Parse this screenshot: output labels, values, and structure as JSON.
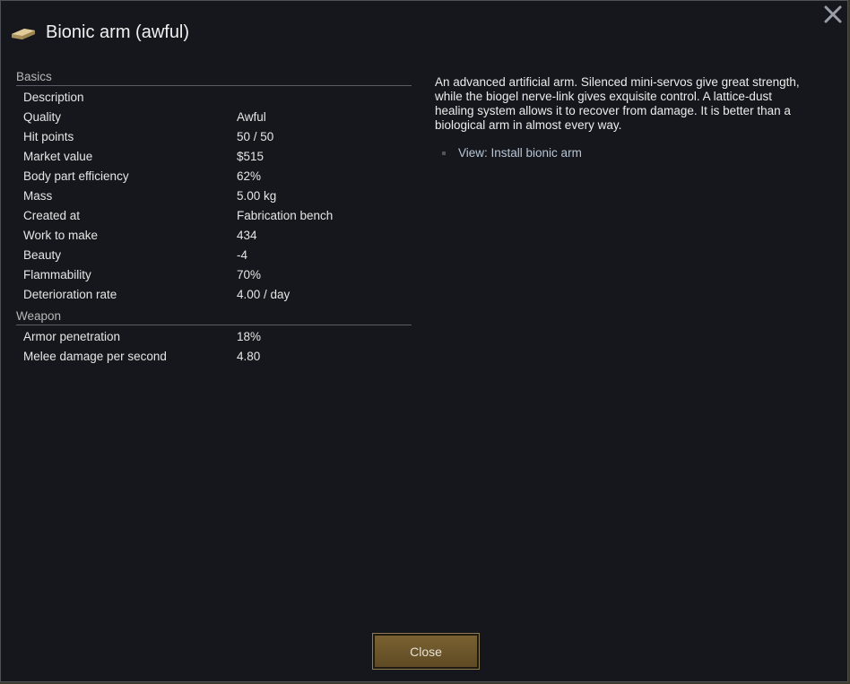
{
  "window": {
    "title": "Bionic arm (awful)",
    "icon": "bionic-arm-icon",
    "close_icon": "close-icon"
  },
  "stats": {
    "sections": [
      {
        "header": "Basics",
        "rows": [
          {
            "label": "Description",
            "value": ""
          },
          {
            "label": "Quality",
            "value": "Awful"
          },
          {
            "label": "Hit points",
            "value": "50 / 50"
          },
          {
            "label": "Market value",
            "value": "$515"
          },
          {
            "label": "Body part efficiency",
            "value": "62%"
          },
          {
            "label": "Mass",
            "value": "5.00 kg"
          },
          {
            "label": "Created at",
            "value": "Fabrication bench"
          },
          {
            "label": "Work to make",
            "value": "434"
          },
          {
            "label": "Beauty",
            "value": "-4"
          },
          {
            "label": "Flammability",
            "value": "70%"
          },
          {
            "label": "Deterioration rate",
            "value": "4.00 / day"
          }
        ]
      },
      {
        "header": "Weapon",
        "rows": [
          {
            "label": "Armor penetration",
            "value": "18%"
          },
          {
            "label": "Melee damage per second",
            "value": "4.80"
          }
        ]
      }
    ]
  },
  "description": {
    "text": "An advanced artificial arm. Silenced mini-servos give great strength, while the biogel nerve-link gives exquisite control. A lattice-dust healing system allows it to recover from damage. It is better than a biological arm in almost every way.",
    "link": "View: Install bionic arm"
  },
  "footer": {
    "close_label": "Close"
  },
  "colors": {
    "background": "#15171c",
    "button": "#6b5429",
    "link": "#b8c6d6"
  }
}
